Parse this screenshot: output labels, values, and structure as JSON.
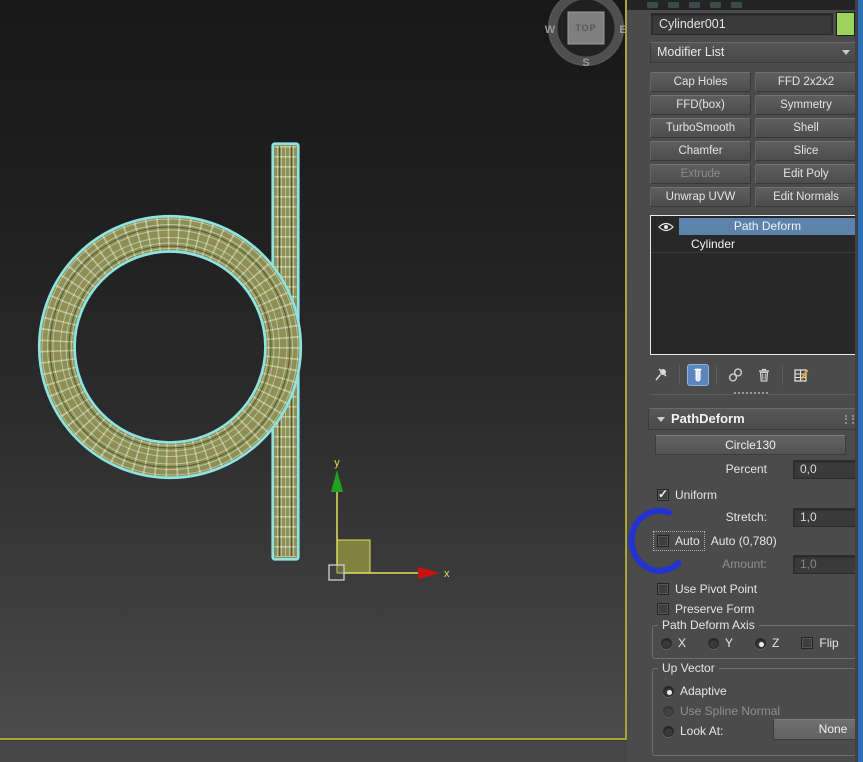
{
  "panel": {
    "object_name": "Cylinder001",
    "modifier_list": "Modifier List",
    "buttons": [
      {
        "label": "Cap Holes",
        "enabled": true
      },
      {
        "label": "FFD 2x2x2",
        "enabled": true
      },
      {
        "label": "FFD(box)",
        "enabled": true
      },
      {
        "label": "Symmetry",
        "enabled": true
      },
      {
        "label": "TurboSmooth",
        "enabled": true
      },
      {
        "label": "Shell",
        "enabled": true
      },
      {
        "label": "Chamfer",
        "enabled": true
      },
      {
        "label": "Slice",
        "enabled": true
      },
      {
        "label": "Extrude",
        "enabled": false
      },
      {
        "label": "Edit Poly",
        "enabled": true
      },
      {
        "label": "Unwrap UVW",
        "enabled": true
      },
      {
        "label": "Edit Normals",
        "enabled": true
      }
    ],
    "stack": {
      "items": [
        {
          "label": "Path Deform",
          "selected": true,
          "eye": true
        },
        {
          "label": "Cylinder",
          "selected": false
        }
      ]
    },
    "stack_toolbar_icons": [
      "pin-stack-icon",
      "show-end-result-icon",
      "make-unique-icon",
      "remove-modifier-icon",
      "configure-modifier-sets-icon"
    ],
    "rollout": {
      "title": "PathDeform",
      "path_button": "Circle130",
      "percent_label": "Percent",
      "percent_value": "0,0",
      "uniform_label": "Uniform",
      "uniform_checked": true,
      "stretch_label": "Stretch:",
      "stretch_value": "1,0",
      "auto_label": "Auto",
      "auto_value_label": "Auto (0,780)",
      "amount_label": "Amount:",
      "amount_value": "1,0",
      "use_pivot_label": "Use Pivot Point",
      "preserve_label": "Preserve Form",
      "axis": {
        "title": "Path Deform Axis",
        "x": "X",
        "y": "Y",
        "z": "Z",
        "flip": "Flip",
        "selected": "Z"
      },
      "up": {
        "title": "Up Vector",
        "adaptive": "Adaptive",
        "spline": "Use Spline Normal",
        "look_at": "Look At:",
        "none_button": "None",
        "selected": "Adaptive"
      }
    }
  },
  "viewport": {
    "viewcube": {
      "face": "TOP",
      "west": "W",
      "east": "E",
      "south": "S"
    },
    "gizmo": {
      "x": "x",
      "y": "y"
    }
  },
  "colors": {
    "stack_selection": "#5d82ab",
    "wireframe_selection_cyan": "#8ce4e4",
    "object_fill_olive": "#8c9054",
    "viewport_border_yellow": "#a9a43b",
    "annotation_blue": "#2433cf",
    "object_color_swatch": "#9bd35e",
    "scrollbar_blue": "#2d6fb4",
    "axis_x_red": "#cc1111",
    "axis_y_green": "#1fa31f",
    "gizmo_yellow": "#e0e060"
  }
}
